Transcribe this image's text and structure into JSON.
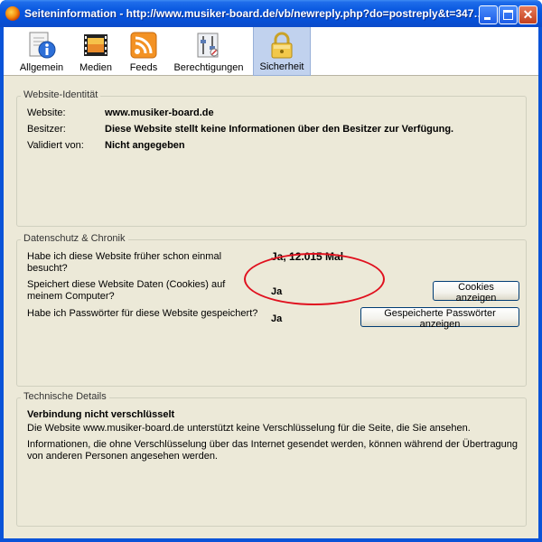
{
  "window": {
    "title": "Seiteninformation - http://www.musiker-board.de/vb/newreply.php?do=postreply&t=347…",
    "controls": {
      "minimize": "minimize-icon",
      "maximize": "maximize-icon",
      "close": "close-icon"
    }
  },
  "tabs": [
    {
      "label": "Allgemein",
      "icon": "info-icon"
    },
    {
      "label": "Medien",
      "icon": "media-icon"
    },
    {
      "label": "Feeds",
      "icon": "rss-icon"
    },
    {
      "label": "Berechtigungen",
      "icon": "permissions-icon"
    },
    {
      "label": "Sicherheit",
      "icon": "lock-icon",
      "active": true
    }
  ],
  "identity": {
    "title": "Website-Identität",
    "website_label": "Website:",
    "website_value": "www.musiker-board.de",
    "owner_label": "Besitzer:",
    "owner_value": "Diese Website stellt keine Informationen über den Besitzer zur Verfügung.",
    "validated_label": "Validiert von:",
    "validated_value": "Nicht angegeben"
  },
  "privacy": {
    "title": "Datenschutz & Chronik",
    "visited_q1": "Habe ich diese Website früher schon einmal",
    "visited_q2": "besucht?",
    "visited_a": "Ja, 12.015 Mal",
    "cookies_q1": "Speichert diese Website Daten (Cookies) auf",
    "cookies_q2": "meinem Computer?",
    "cookies_a": "Ja",
    "cookies_button": "Cookies anzeigen",
    "passwords_q": "Habe ich Passwörter für diese Website gespeichert?",
    "passwords_a": "Ja",
    "passwords_button": "Gespeicherte Passwörter anzeigen"
  },
  "technical": {
    "title": "Technische Details",
    "heading": "Verbindung nicht verschlüsselt",
    "line1": "Die Website www.musiker-board.de unterstützt keine Verschlüsselung für die Seite, die Sie ansehen.",
    "line2a": "Informationen, die ohne Verschlüsselung über das Internet gesendet werden, können während der Übertragung",
    "line2b": "von anderen Personen angesehen werden."
  },
  "colors": {
    "titlebar": "#0a53d8",
    "panel": "#ece9d8",
    "highlight_ellipse": "#e0101e",
    "active_tab": "#c1d2ee"
  }
}
